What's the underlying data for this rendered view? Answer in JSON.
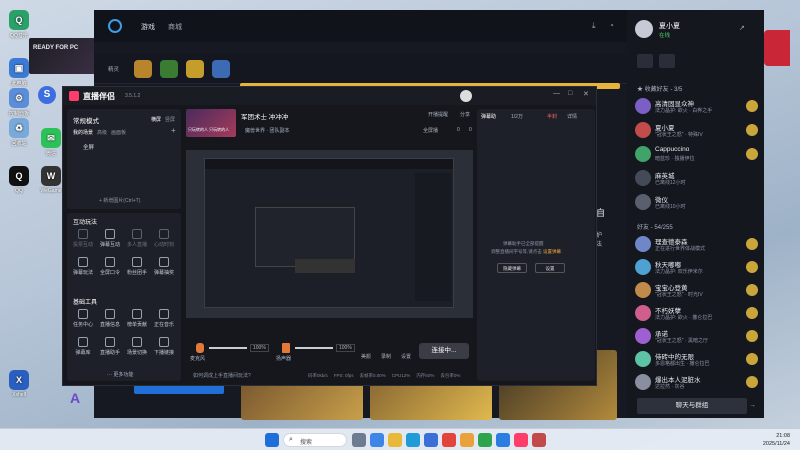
{
  "desktop": {
    "icons": [
      {
        "label": "QQ音乐",
        "color": "#2aa168",
        "glyph": "Q"
      },
      {
        "label": "此电脑",
        "color": "#3b7bd6",
        "glyph": "▣"
      },
      {
        "label": "控制面板",
        "color": "#5b8ed8",
        "glyph": "⚙"
      },
      {
        "label": "回收站",
        "color": "#78a9d9",
        "glyph": "♻"
      },
      {
        "label": "微信",
        "color": "#2dc15a",
        "glyph": "✉"
      },
      {
        "label": "QQ",
        "color": "#111",
        "glyph": "Q"
      },
      {
        "label": "WeGame",
        "color": "#333",
        "glyph": "W"
      },
      {
        "label": "Xshell",
        "color": "#2b5fbf",
        "glyph": "X"
      }
    ],
    "poster_text": "READY FOR PC",
    "sogou_label": "S"
  },
  "bnet": {
    "tabs": [
      "游戏",
      "商城"
    ],
    "sub_label": "精灵",
    "right_text_1": "自",
    "right_text_2": "护\n法"
  },
  "friends": {
    "user_name": "夏小夏",
    "user_status": "在线",
    "favorites_header": "★ 收藏好友 - 3/5",
    "friends_header": "好友 - 54/255",
    "favorites": [
      {
        "name": "高清固显众神",
        "status": "法力晶护: 欲火 · 白桦之手",
        "avatar": "#7b5fc4"
      },
      {
        "name": "夏小夏",
        "status": "\"冠状王之怒\" · 特殊IV",
        "avatar": "#c44b4b"
      },
      {
        "name": "Cappuccino",
        "status": "暗蓝珍 · 独播伊拉",
        "avatar": "#3fa36a"
      },
      {
        "name": "麻英城",
        "status": "已离线12小时",
        "avatar": "#444a57"
      },
      {
        "name": "微仪",
        "status": "已离线10小时",
        "avatar": "#5a5f6d"
      }
    ],
    "list": [
      {
        "name": "理查德泰森",
        "status": "正在进行世界体战模式",
        "avatar": "#6f87c9"
      },
      {
        "name": "秋天嘟嘟",
        "status": "法力晶护: 欢乐伊米尔",
        "avatar": "#4fa1d2"
      },
      {
        "name": "宝宝心登黄",
        "status": "\"冠状王之怒\" · 时光IV",
        "avatar": "#c08a4a"
      },
      {
        "name": "不朽妖孽",
        "status": "法力晶护: 欲火 · 撒仑拉巴",
        "avatar": "#d05e8c"
      },
      {
        "name": "承诺",
        "status": "\"冠状王之怒\" · 黑暗之厅",
        "avatar": "#9e5fd0"
      },
      {
        "name": "侍砖中的无限",
        "status": "多恩格都出生 · 撒仑拉巴",
        "avatar": "#5ec2a4"
      },
      {
        "name": "爆出本人泥脏水",
        "status": "达拉然 · 灰谷",
        "avatar": "#8a8fa0"
      }
    ],
    "chat_button": "聊天与群组",
    "game_badge": "W"
  },
  "live": {
    "app_title": "直播伴侣",
    "version": "3.5.1.2",
    "mode_label": "常规模式",
    "orientation": [
      "横屏",
      "竖屏"
    ],
    "scene_tabs": [
      "我的场景",
      "高级",
      "画面板"
    ],
    "scene_item": "全屏",
    "add_source": "+ 新增图片(Ctrl+T)",
    "stream_title": "军团术士 冲冲冲",
    "stream_sub": "魔兽世界 · 团队副本",
    "stream_thumb_text": "只玩转的人 只玩转的人",
    "top_actions": [
      "开播提醒",
      "分享"
    ],
    "room_row": [
      "全屏播",
      "0",
      "0"
    ],
    "interact_header": "互动玩法",
    "interact_tools": [
      "投票互动",
      "弹幕互动",
      "多人直播",
      "心动时刻",
      "弹幕玩法",
      "全屏口令",
      "粉丝团手",
      "弹幕抽奖"
    ],
    "basic_header": "基础工具",
    "basic_tools": [
      "任务中心",
      "直播信息",
      "榜单贡献",
      "正在音乐",
      "弹幕库",
      "直播助手",
      "场景切换",
      "下播链接"
    ],
    "more_tools": "··· 更多功能",
    "bottom_controls": [
      "麦克风",
      "扬声器",
      "美颜",
      "录制",
      "设置"
    ],
    "mic_level": "100%",
    "speaker_level": "100%",
    "start_button": "连接中...",
    "status_bar": "如何调成上手直播间玩法?",
    "stats": [
      "码率0kb/s",
      "FPS: 0fps",
      "丢帧率0.00%",
      "CPU12%",
      "内存60%",
      "丢包率0%"
    ],
    "chat_tabs": [
      "弹幕助",
      "1/2万"
    ],
    "chat_tag": "半封",
    "chat_detail": "详情",
    "chat_placeholder_1": "弹幕助手已全部提醒",
    "chat_placeholder_2": "调整直播间字号等,请点击",
    "chat_link": "设置弹幕",
    "chat_buttons": [
      "隐藏弹幕",
      "设置"
    ]
  },
  "taskbar": {
    "search": "搜索",
    "time": "21:08",
    "date": "2025/11/24"
  }
}
